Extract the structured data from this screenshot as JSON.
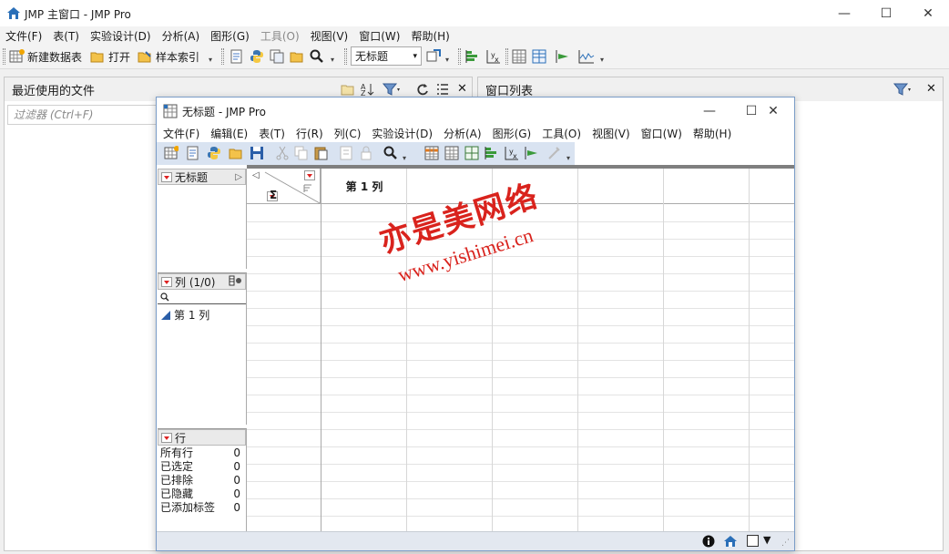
{
  "main_window": {
    "title": "JMP 主窗口 - JMP Pro",
    "controls": {
      "minimize": "—",
      "maximize": "☐",
      "close": "✕"
    }
  },
  "main_menu": [
    "文件(F)",
    "表(T)",
    "实验设计(D)",
    "分析(A)",
    "图形(G)",
    "工具(O)",
    "视图(V)",
    "窗口(W)",
    "帮助(H)"
  ],
  "main_toolbar": {
    "new_table": "新建数据表",
    "open": "打开",
    "sample_index": "样本索引",
    "table_select": "无标题"
  },
  "recent_panel": {
    "title": "最近使用的文件",
    "filter_placeholder": "过滤器 (Ctrl+F)"
  },
  "window_list_panel": {
    "title": "窗口列表"
  },
  "child_window": {
    "title": "无标题 - JMP Pro",
    "controls": {
      "minimize": "—",
      "maximize": "☐",
      "close": "✕"
    },
    "menu": [
      "文件(F)",
      "编辑(E)",
      "表(T)",
      "行(R)",
      "列(C)",
      "实验设计(D)",
      "分析(A)",
      "图形(G)",
      "工具(O)",
      "视图(V)",
      "窗口(W)",
      "帮助(H)"
    ],
    "table_panel": {
      "name": "无标题"
    },
    "columns_panel": {
      "header": "列 (1/0)",
      "items": [
        "第 1 列"
      ]
    },
    "rows_panel": {
      "header": "行",
      "stats": [
        {
          "label": "所有行",
          "value": "0"
        },
        {
          "label": "已选定",
          "value": "0"
        },
        {
          "label": "已排除",
          "value": "0"
        },
        {
          "label": "已隐藏",
          "value": "0"
        },
        {
          "label": "已添加标签",
          "value": "0"
        }
      ]
    },
    "grid": {
      "column_header": "第 1 列",
      "sigma": "Σ"
    }
  },
  "watermark": {
    "line1": "亦是美网络",
    "line2": "www.yishimei.cn",
    "color": "#d9231d"
  }
}
